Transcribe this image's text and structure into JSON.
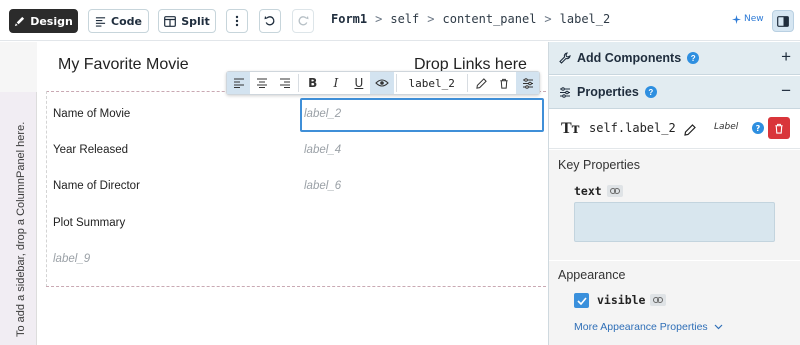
{
  "toolbar": {
    "design_label": "Design",
    "code_label": "Code",
    "split_label": "Split",
    "new_label": "New"
  },
  "breadcrumb": {
    "items": [
      "Form1",
      "self",
      "content_panel",
      "label_2"
    ],
    "separator": ">"
  },
  "canvas": {
    "title": "My Favorite Movie",
    "drop_links": "Drop Links here",
    "sidebar_hint": "To add a sidebar, drop a ColumnPanel here.",
    "rows": [
      {
        "label": "Name of Movie",
        "value": "label_2"
      },
      {
        "label": "Year Released",
        "value": "label_4"
      },
      {
        "label": "Name of Director",
        "value": "label_6"
      },
      {
        "label": "Plot Summary",
        "value": ""
      }
    ],
    "extra_label": "label_9"
  },
  "format_toolbar": {
    "component_name": "label_2",
    "bold": "B",
    "italic": "I",
    "underline": "U"
  },
  "panel": {
    "add_components": "Add Components",
    "add_components_toggle": "+",
    "properties": "Properties",
    "properties_toggle": "−",
    "component_icon": "Tт",
    "component_name": "self.label_2",
    "component_type": "Label",
    "help_glyph": "?",
    "key_properties": "Key Properties",
    "text_prop": "text",
    "text_value": "",
    "appearance": "Appearance",
    "visible_prop": "visible",
    "visible_checked": true,
    "more_appearance": "More Appearance Properties"
  },
  "colors": {
    "accent": "#3a90dc",
    "delete": "#d9353a",
    "panel_header": "#e2ecf1"
  }
}
